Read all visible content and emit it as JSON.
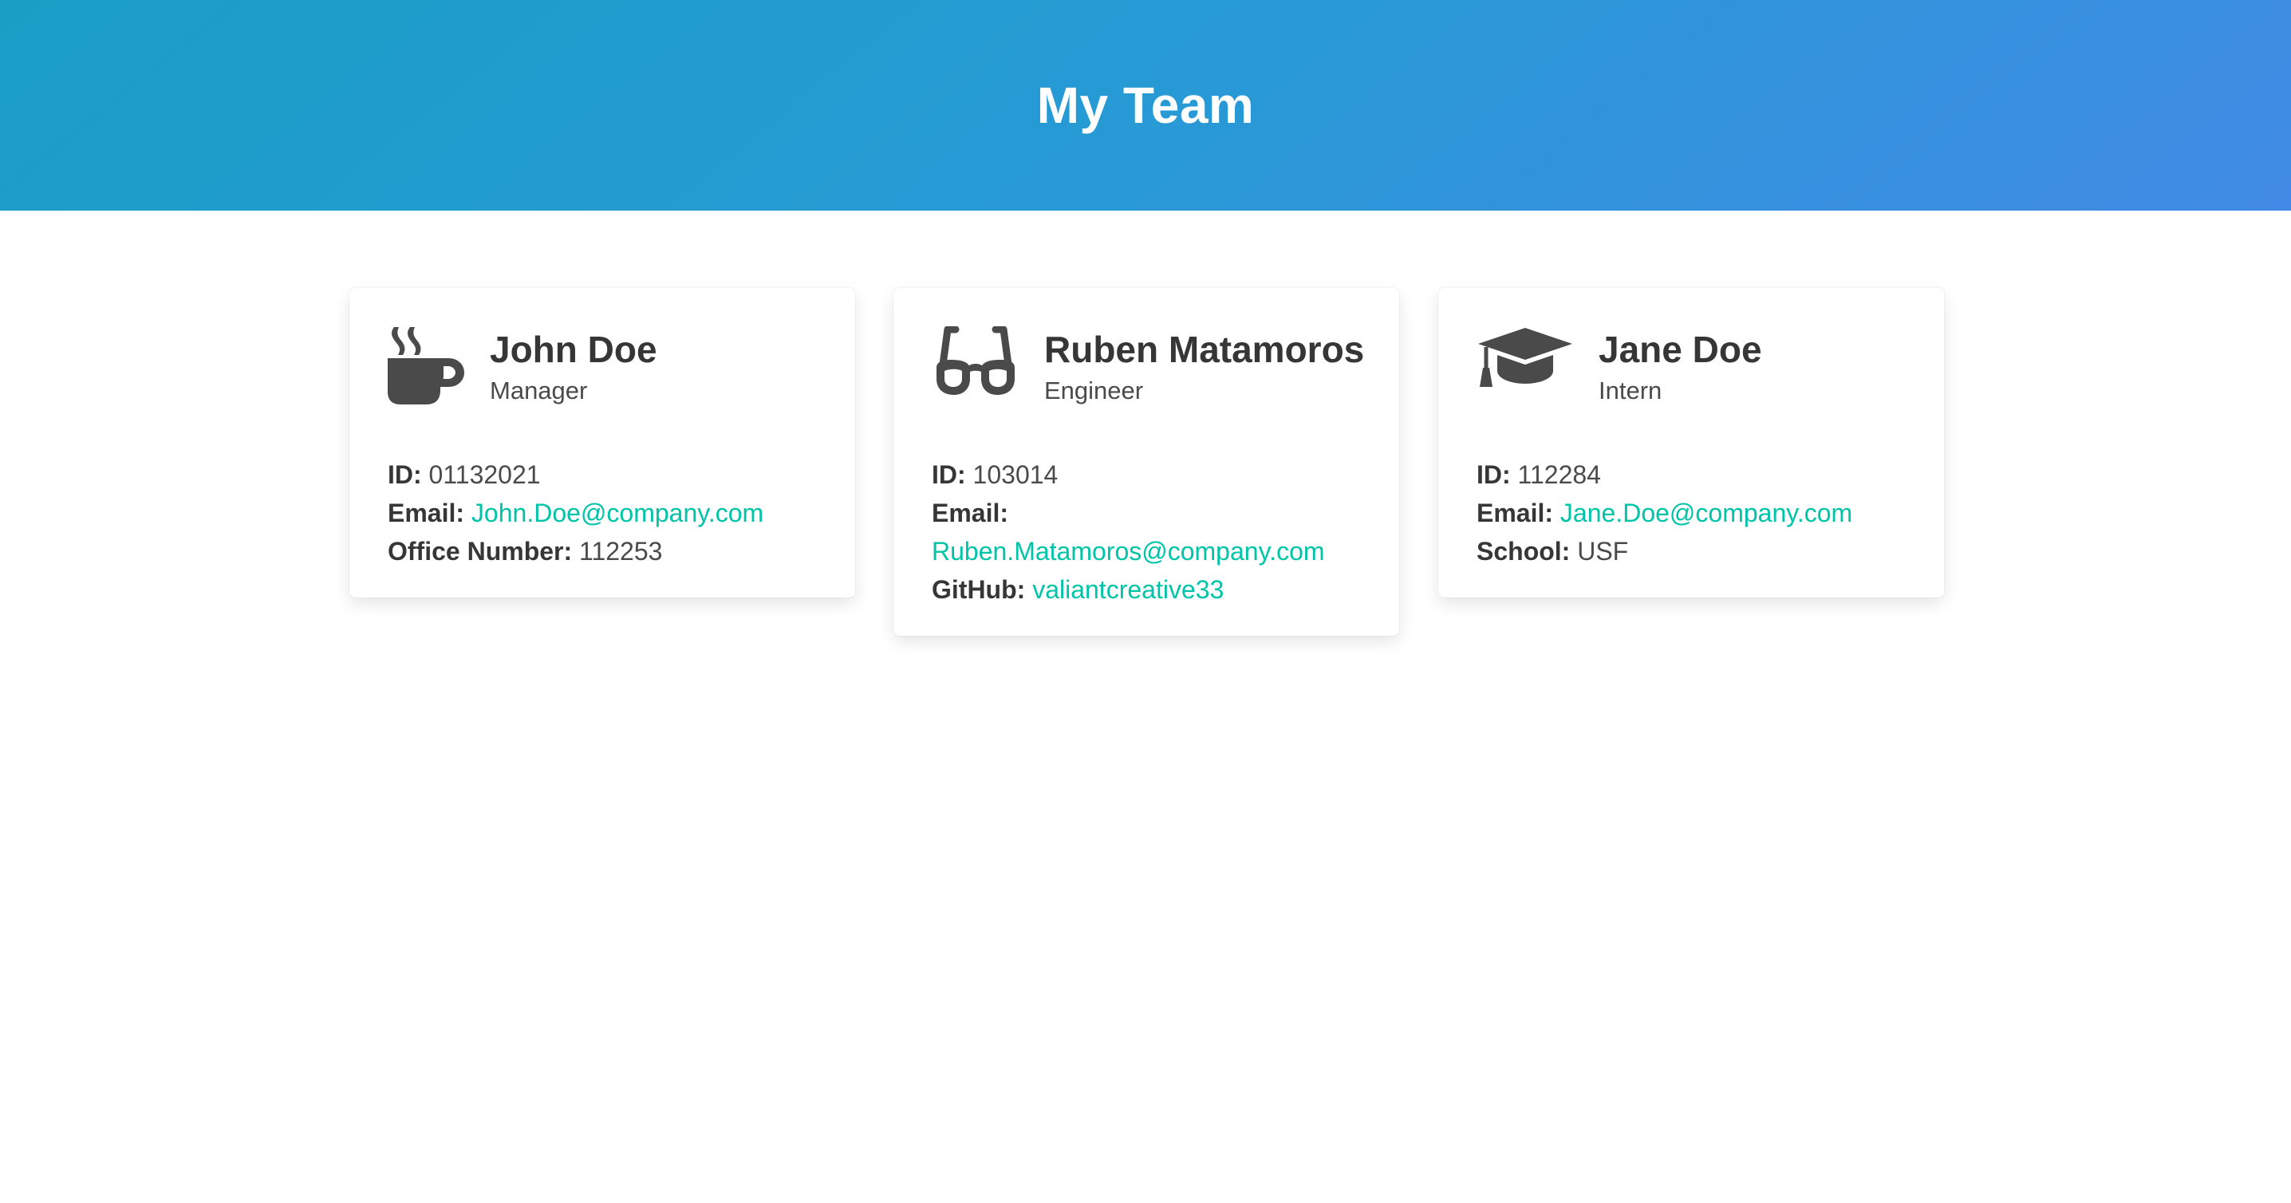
{
  "header": {
    "title": "My Team"
  },
  "colors": {
    "link": "#00c4a7",
    "hero_start": "#1a9ec6",
    "hero_end": "#418ae5"
  },
  "team": [
    {
      "name": "John Doe",
      "role": "Manager",
      "icon": "coffee-icon",
      "id_label": "ID:",
      "id": "01132021",
      "email_label": "Email:",
      "email": "John.Doe@company.com",
      "extra_label": "Office Number:",
      "extra": "112253"
    },
    {
      "name": "Ruben Matamoros",
      "role": "Engineer",
      "icon": "glasses-icon",
      "id_label": "ID:",
      "id": "103014",
      "email_label": "Email:",
      "email": "Ruben.Matamoros@company.com",
      "extra_label": "GitHub:",
      "extra": "valiantcreative33"
    },
    {
      "name": "Jane Doe",
      "role": "Intern",
      "icon": "graduation-cap-icon",
      "id_label": "ID:",
      "id": "112284",
      "email_label": "Email:",
      "email": "Jane.Doe@company.com",
      "extra_label": "School:",
      "extra": "USF"
    }
  ]
}
